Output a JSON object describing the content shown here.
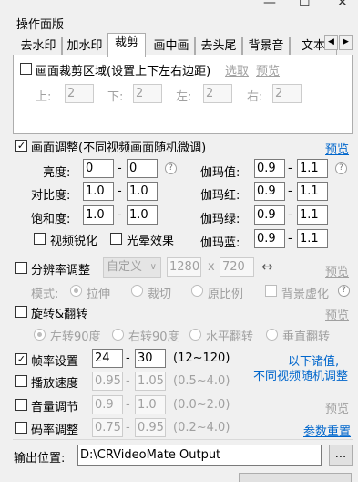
{
  "window": {
    "minimize_glyph": "—",
    "restore_glyph": "☐",
    "close_glyph": "✕"
  },
  "group_title": "操作面版",
  "tabs": [
    "去水印",
    "加水印",
    "裁剪",
    "画中画",
    "去头尾",
    "背景音",
    "文本"
  ],
  "tab_scroll": {
    "left": "◀",
    "right": "▶"
  },
  "crop": {
    "checkbox_label": "画面裁剪区域(设置上下左右边距)",
    "select_link": "选取",
    "preview_link": "预览",
    "top_label": "上:",
    "top_value": "2",
    "bottom_label": "下:",
    "bottom_value": "2",
    "left_label": "左:",
    "left_value": "2",
    "right_label": "右:",
    "right_value": "2"
  },
  "adjust": {
    "checkbox_label": "画面调整(不同视频画面随机微调)",
    "checked": "✓",
    "preview_link": "预览",
    "dash": "-",
    "help": "?",
    "brightness_label": "亮度:",
    "brightness_min": "0",
    "brightness_max": "0",
    "contrast_label": "对比度:",
    "contrast_min": "1.0",
    "contrast_max": "1.0",
    "saturation_label": "饱和度:",
    "saturation_min": "1.0",
    "saturation_max": "1.0",
    "gamma_label": "伽玛值:",
    "gamma_min": "0.9",
    "gamma_max": "1.1",
    "gamma_red_label": "伽玛红:",
    "gamma_red_min": "0.9",
    "gamma_red_max": "1.1",
    "gamma_green_label": "伽玛绿:",
    "gamma_green_min": "0.9",
    "gamma_green_max": "1.1",
    "gamma_blue_label": "伽玛蓝:",
    "gamma_blue_min": "0.9",
    "gamma_blue_max": "1.1",
    "sharpen_label": "视频锐化",
    "glow_label": "光晕效果"
  },
  "resolution": {
    "checkbox_label": "分辨率调整",
    "preset": "自定义",
    "width": "1280",
    "times": "x",
    "height": "720",
    "swap_glyph": "↔",
    "preview_link": "预览",
    "mode_label": "模式:",
    "mode_stretch": "拉伸",
    "mode_crop": "裁切",
    "mode_keep": "原比例",
    "bg_blur_label": "背景虚化"
  },
  "rotate": {
    "checkbox_label": "旋转&翻转",
    "preview_link": "预览",
    "left90": "左转90度",
    "right90": "右转90度",
    "hflip": "水平翻转",
    "vflip": "垂直翻转"
  },
  "framerate": {
    "checkbox_label": "帧率设置",
    "checked": "✓",
    "min": "24",
    "max": "30",
    "range_hint": "(12~120)"
  },
  "note_line1": "以下诸值,",
  "note_line2": "不同视频随机调整",
  "speed": {
    "checkbox_label": "播放速度",
    "min": "0.95",
    "max": "1.05",
    "range_hint": "(0.5~4.0)"
  },
  "volume": {
    "checkbox_label": "音量调节",
    "min": "0.9",
    "max": "1.0",
    "range_hint": "(0.0~2.0)",
    "preview_link": "预览"
  },
  "bitrate": {
    "checkbox_label": "码率调整",
    "min": "0.75",
    "max": "0.95",
    "range_hint": "(0.2~4.0)",
    "reset_link": "参数重置"
  },
  "output": {
    "label": "输出位置:",
    "path": "D:\\CRVideoMate Output",
    "browse": "..."
  },
  "colors": {
    "link": "#0066cc",
    "disabled_text": "#a0a0a0",
    "panel_bg": "#f0f0f0"
  }
}
